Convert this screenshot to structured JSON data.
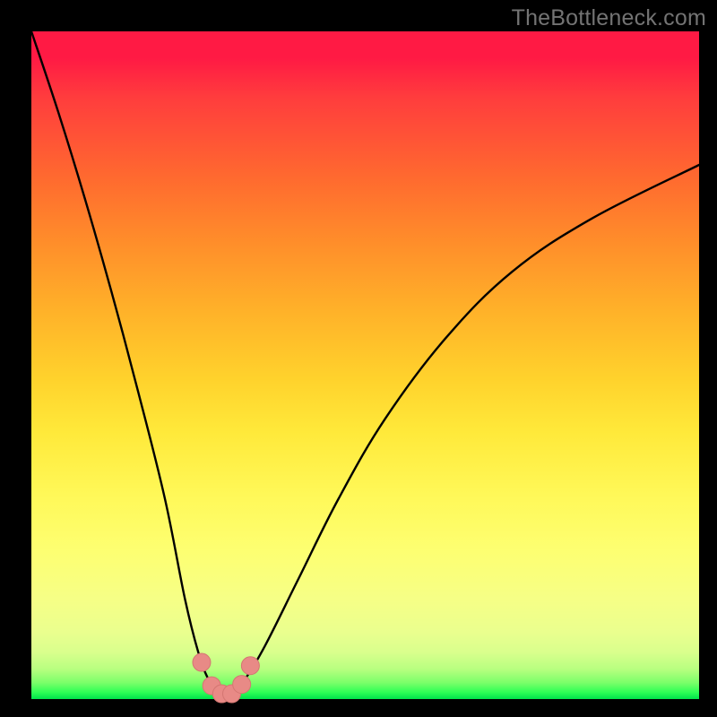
{
  "watermark": "TheBottleneck.com",
  "colors": {
    "frame": "#000000",
    "curve": "#000000",
    "marker_fill": "#e88a86",
    "marker_stroke": "#d47672"
  },
  "chart_data": {
    "type": "line",
    "title": "",
    "xlabel": "",
    "ylabel": "",
    "xlim": [
      0,
      100
    ],
    "ylim": [
      0,
      100
    ],
    "series": [
      {
        "name": "bottleneck-curve",
        "x": [
          0,
          4,
          8,
          12,
          16,
          20,
          23,
          25,
          26.5,
          28,
          30,
          32,
          35,
          40,
          46,
          53,
          62,
          72,
          84,
          100
        ],
        "values": [
          100,
          88,
          75,
          61,
          46,
          30,
          15,
          7,
          3,
          1,
          1,
          3,
          8,
          18,
          30,
          42,
          54,
          64,
          72,
          80
        ]
      }
    ],
    "markers": {
      "name": "trough-markers",
      "x": [
        25.5,
        27,
        28.5,
        30,
        31.5,
        32.8
      ],
      "values": [
        5.5,
        2.0,
        0.8,
        0.8,
        2.2,
        5.0
      ],
      "radius": 10
    }
  }
}
